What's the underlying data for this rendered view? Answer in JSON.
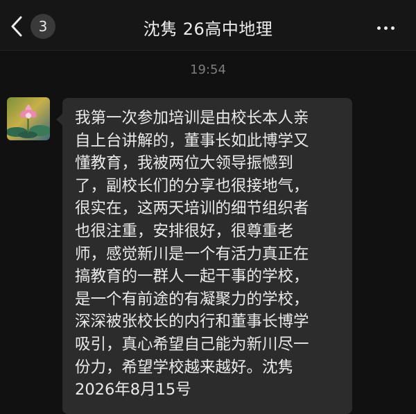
{
  "header": {
    "back_icon": "chevron-left-icon",
    "unread_count": "3",
    "title": "沈隽 26高中地理",
    "more_icon": "ellipsis-icon"
  },
  "chat": {
    "timestamp": "19:54",
    "message": {
      "avatar_icon": "lotus-avatar-image",
      "lines": [
        "我第一次参加培训是由校长本人亲",
        "自上台讲解的，董事长如此博学又",
        "懂教育，我被两位大领导振憾到",
        "了，副校长们的分享也很接地气，",
        "很实在，这两天培训的细节组织者",
        "也很注重，安排很好，很尊重老",
        "师，感觉新川是一个有活力真正在",
        "搞教育的一群人一起干事的学校，",
        "是一个有前途的有凝聚力的学校，",
        "深深被张校长的内行和董事长博学",
        "吸引，真心希望自己能为新川尽一",
        "份力，希望学校越来越好。沈隽",
        "2026年8月15号"
      ]
    }
  },
  "colors": {
    "background": "#111111",
    "bubble": "#2c2c2c",
    "text": "#eaeaea",
    "timestamp": "#7d7d7d",
    "badge": "#3a3a3a"
  }
}
